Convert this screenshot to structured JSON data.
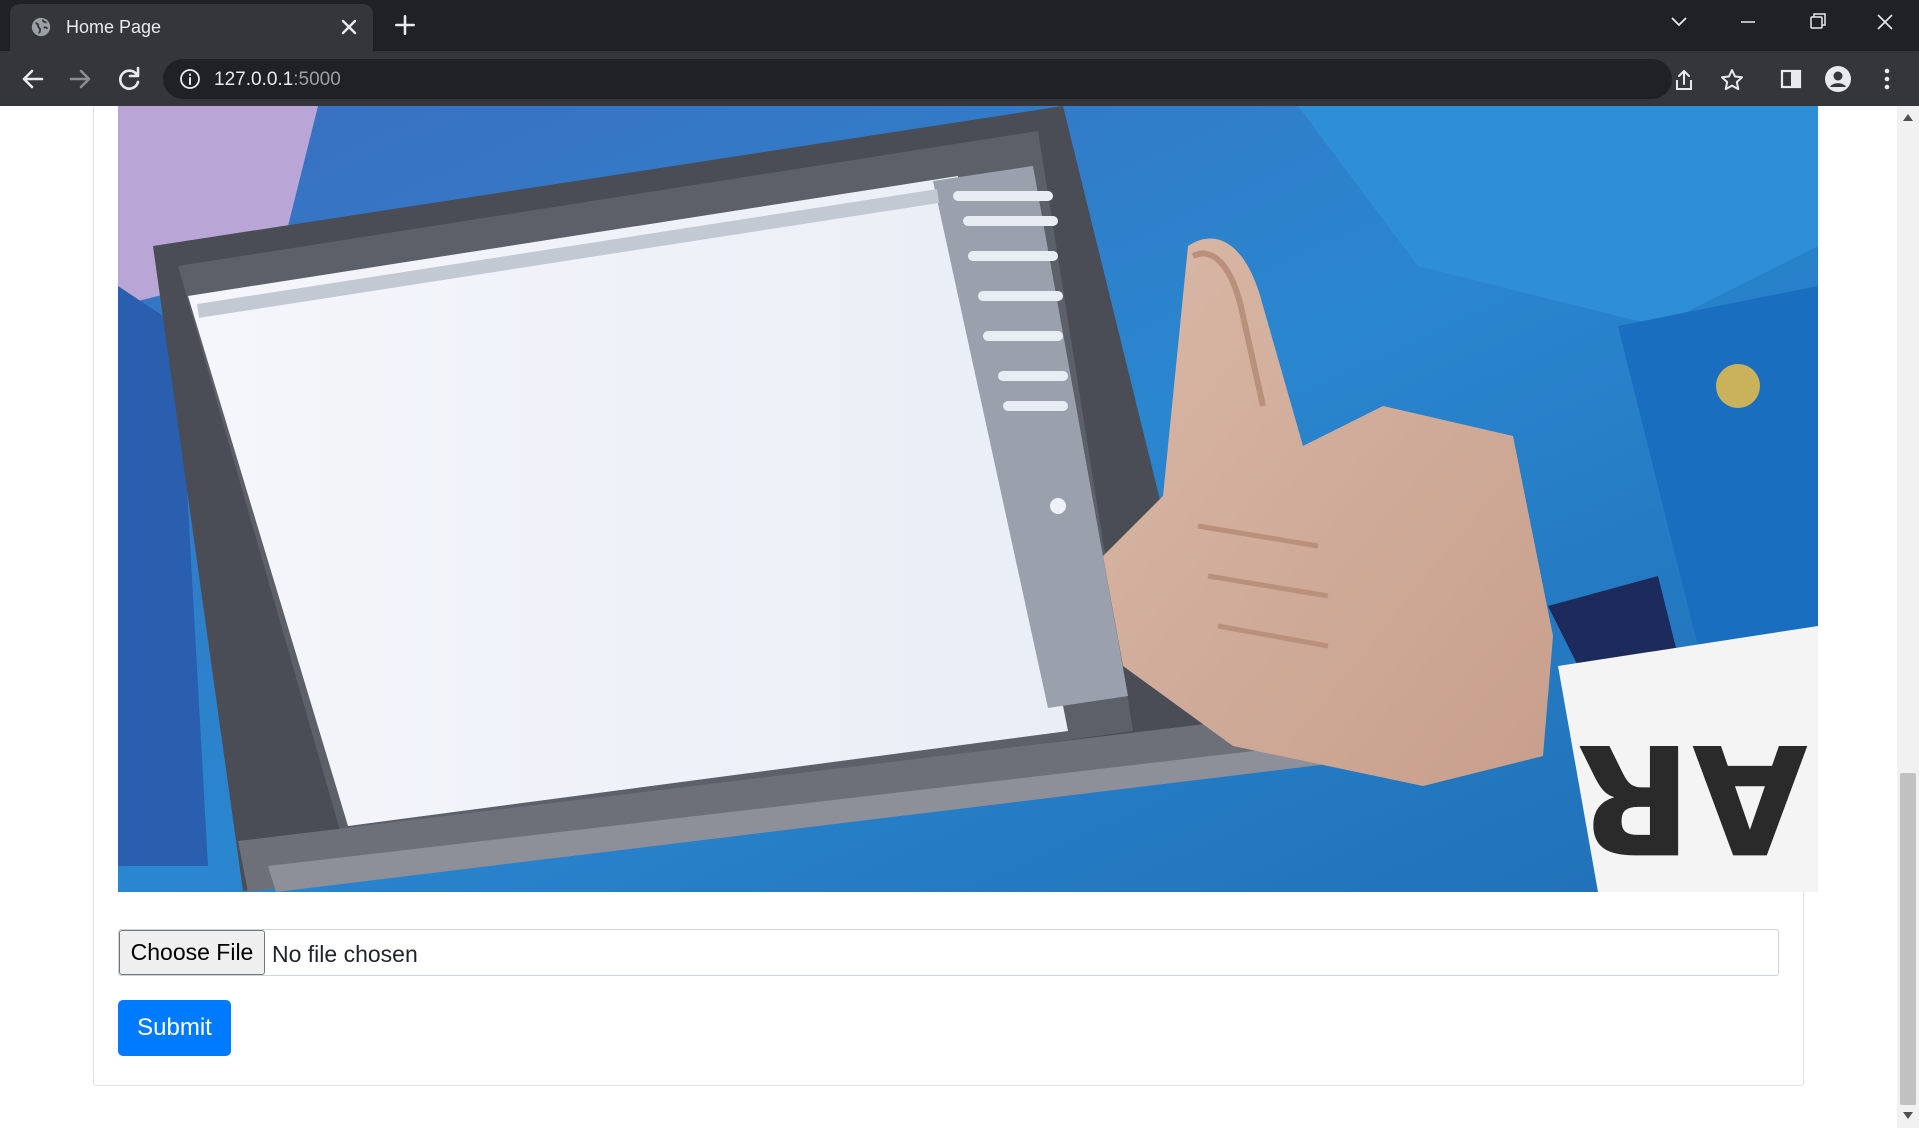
{
  "browser": {
    "tab_title": "Home Page",
    "url_host": "127.0.0.1",
    "url_port": ":5000"
  },
  "page": {
    "image_alt": "laptop-thumbs-up-photo",
    "choose_file_label": "Choose File",
    "file_status": "No file chosen",
    "submit_label": "Submit"
  },
  "colors": {
    "primary": "#007bff",
    "chrome_dark": "#202124",
    "chrome_toolbar": "#35363a"
  }
}
